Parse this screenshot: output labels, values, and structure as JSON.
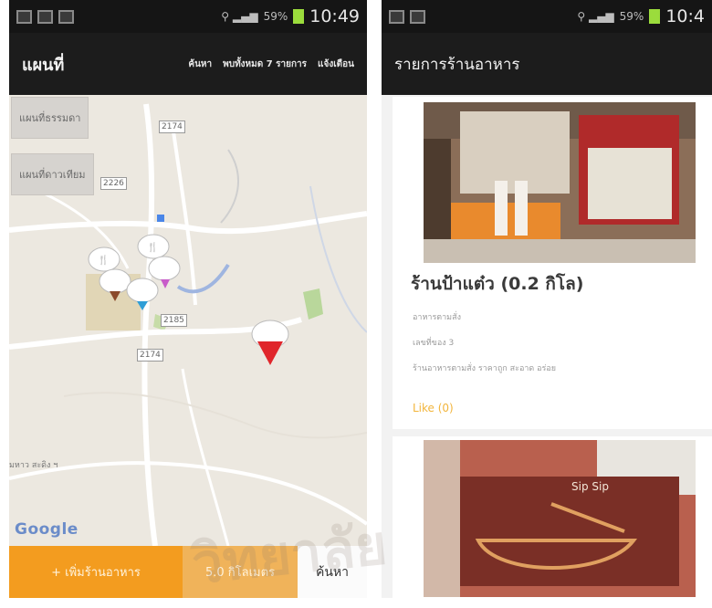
{
  "status_left": {
    "time": "10:49",
    "signal": "59%"
  },
  "status_right": {
    "time": "10:4",
    "signal": "59%"
  },
  "map_screen": {
    "title": "แผนที่",
    "actions": [
      "ค้นหา",
      "พบทั้งหมด 7 รายการ",
      "แจ้งเตือน"
    ],
    "map_buttons": [
      "แผนที่ธรรมดา",
      "แผนที่ดาวเทียม"
    ],
    "road_labels": [
      "2174",
      "2226",
      "2185",
      "2174"
    ],
    "place_label": "มหาว สะดิง ฯ",
    "google_label": "Google",
    "bottom": {
      "add": "+ เพิ่มร้านอาหาร",
      "distance": "5.0 กิโลเมตร",
      "search": "ค้นหา"
    }
  },
  "list_screen": {
    "title": "รายการร้านอาหาร",
    "restaurants": [
      {
        "name": "ร้านป้าแต๋ว (0.2 กิโล)",
        "line1": "อาหารตามสั่ง",
        "line2": "เลขที่ของ 3",
        "line3": "ร้านอาหารตามสั่ง ราคาถูก สะอาด อร่อย",
        "like": "Like (0)"
      }
    ],
    "second_sign": "Sip Sip"
  },
  "watermark": "วิทยาลัย",
  "colors": {
    "accent_orange": "#f39c1f",
    "marker_red": "#e0262b",
    "appbar": "#1c1c1c"
  }
}
